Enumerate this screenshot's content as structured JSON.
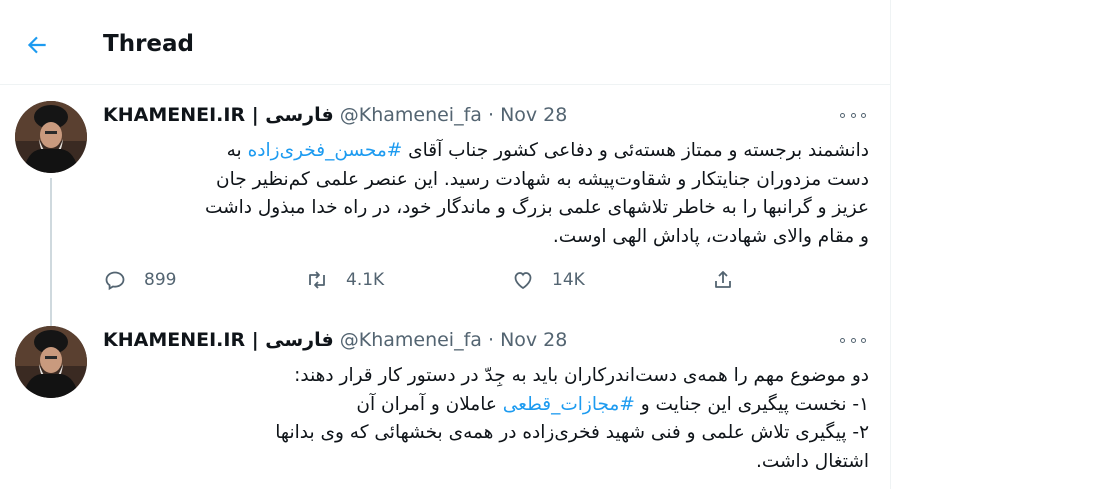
{
  "header": {
    "title": "Thread",
    "back_icon": "arrow-left-icon"
  },
  "tweets": [
    {
      "author_name": "KHAMENEI.IR | فارسی",
      "handle": "@Khamenei_fa",
      "separator": "·",
      "date": "Nov 28",
      "text_before": "دانشمند برجسته و ممتاز هسته‌ئی و دفاعی کشور جناب آقای ",
      "hashtag": "#محسن_فخری‌زاده",
      "text_after": " به\nدست مزدوران جنایتکار و شقاوت‌پیشه به شهادت رسید. این عنصر علمی کم‌نظیر جان\nعزیز و گرانبها را به خاطر تلاشهای علمی بزرگ و ماندگار خود، در راه خدا مبذول داشت\nو مقام والای شهادت، پاداش الهی اوست.",
      "replies": "899",
      "retweets": "4.1K",
      "likes": "14K"
    },
    {
      "author_name": "KHAMENEI.IR | فارسی",
      "handle": "@Khamenei_fa",
      "separator": "·",
      "date": "Nov 28",
      "text_before": "دو موضوع مهم را همه‌ی دست‌اندرکاران باید به جِدّ در دستور کار قرار دهند:\n۱- نخست پیگیری این جنایت و ",
      "hashtag": "#مجازات_قطعی",
      "text_after": " عاملان و آمران آن\n۲- پیگیری تلاش علمی و فنی شهید فخری‌زاده در همه‌ی بخشهائی که وی بدانها\nاشتغال داشت."
    }
  ],
  "colors": {
    "accent": "#1d9bf0",
    "muted": "#536471",
    "text": "#0f1419",
    "border": "#eff3f4"
  }
}
